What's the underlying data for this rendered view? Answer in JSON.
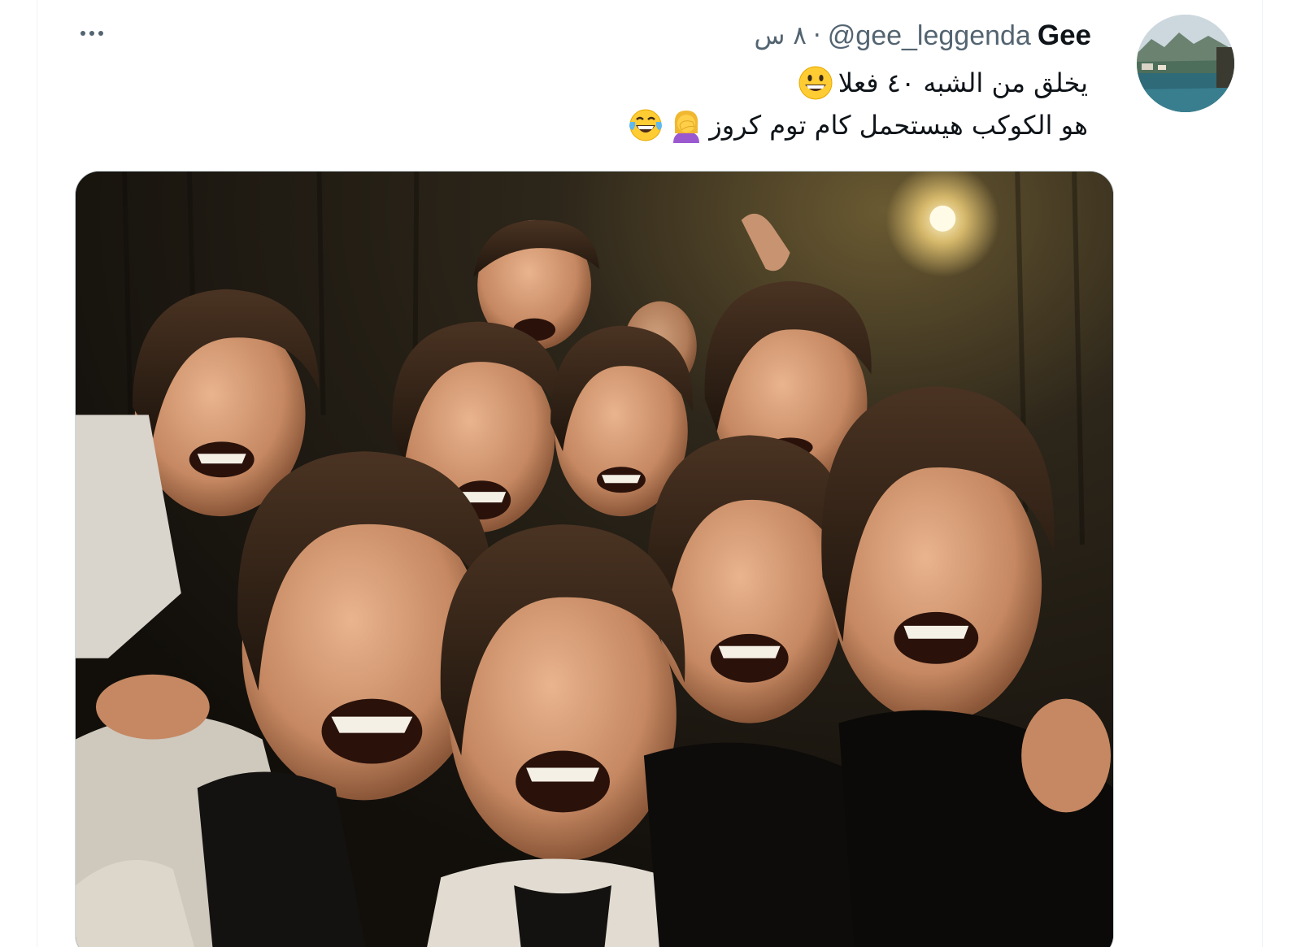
{
  "tweet": {
    "display_name": "Gee",
    "handle": "@gee_leggenda",
    "separator": "·",
    "time": "٨ س",
    "lines": [
      {
        "text": "يخلق من الشبه ٤٠ فعلا",
        "emojis": [
          "grinning-face-emoji"
        ]
      },
      {
        "text": "هو الكوكب هيستحمل كام توم كروز",
        "emojis": [
          "woman-facepalming-emoji",
          "face-with-tears-of-joy-emoji"
        ]
      }
    ],
    "more_label": "More"
  },
  "colors": {
    "text_primary": "#0f1419",
    "text_secondary": "#536471",
    "border": "#cfd9de"
  }
}
